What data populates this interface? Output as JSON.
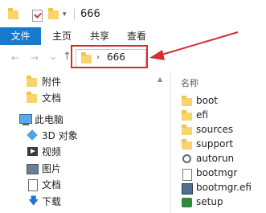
{
  "window": {
    "title": "666",
    "qat_dropdown": "▾"
  },
  "ribbon": {
    "tabs": [
      "文件",
      "主页",
      "共享",
      "查看"
    ]
  },
  "navbar": {
    "back": "←",
    "forward": "→",
    "recent": "⌄",
    "up": "↑",
    "path_chevron": "›",
    "path": "666"
  },
  "nav_pane": {
    "items": [
      {
        "label": "附件",
        "icon": "folder-icon"
      },
      {
        "label": "文档",
        "icon": "folder-icon"
      },
      {
        "label": "此电脑",
        "icon": "computer-icon"
      },
      {
        "label": "3D 对象",
        "icon": "3d-objects-icon"
      },
      {
        "label": "视频",
        "icon": "video-icon"
      },
      {
        "label": "图片",
        "icon": "pictures-icon"
      },
      {
        "label": "文档",
        "icon": "documents-icon"
      },
      {
        "label": "下载",
        "icon": "download-icon"
      }
    ],
    "scroll_up": "▲"
  },
  "file_pane": {
    "column_header": "名称",
    "files": [
      {
        "name": "boot",
        "icon": "folder-icon"
      },
      {
        "name": "efi",
        "icon": "folder-icon"
      },
      {
        "name": "sources",
        "icon": "folder-icon"
      },
      {
        "name": "support",
        "icon": "folder-icon"
      },
      {
        "name": "autorun",
        "icon": "settings-file-icon"
      },
      {
        "name": "bootmgr",
        "icon": "file-icon"
      },
      {
        "name": "bootmgr.efi",
        "icon": "efi-file-icon"
      },
      {
        "name": "setup",
        "icon": "setup-app-icon"
      }
    ]
  },
  "colors": {
    "accent": "#1979ca",
    "annotation": "#d32f2f",
    "folder": "#f8d46b"
  }
}
